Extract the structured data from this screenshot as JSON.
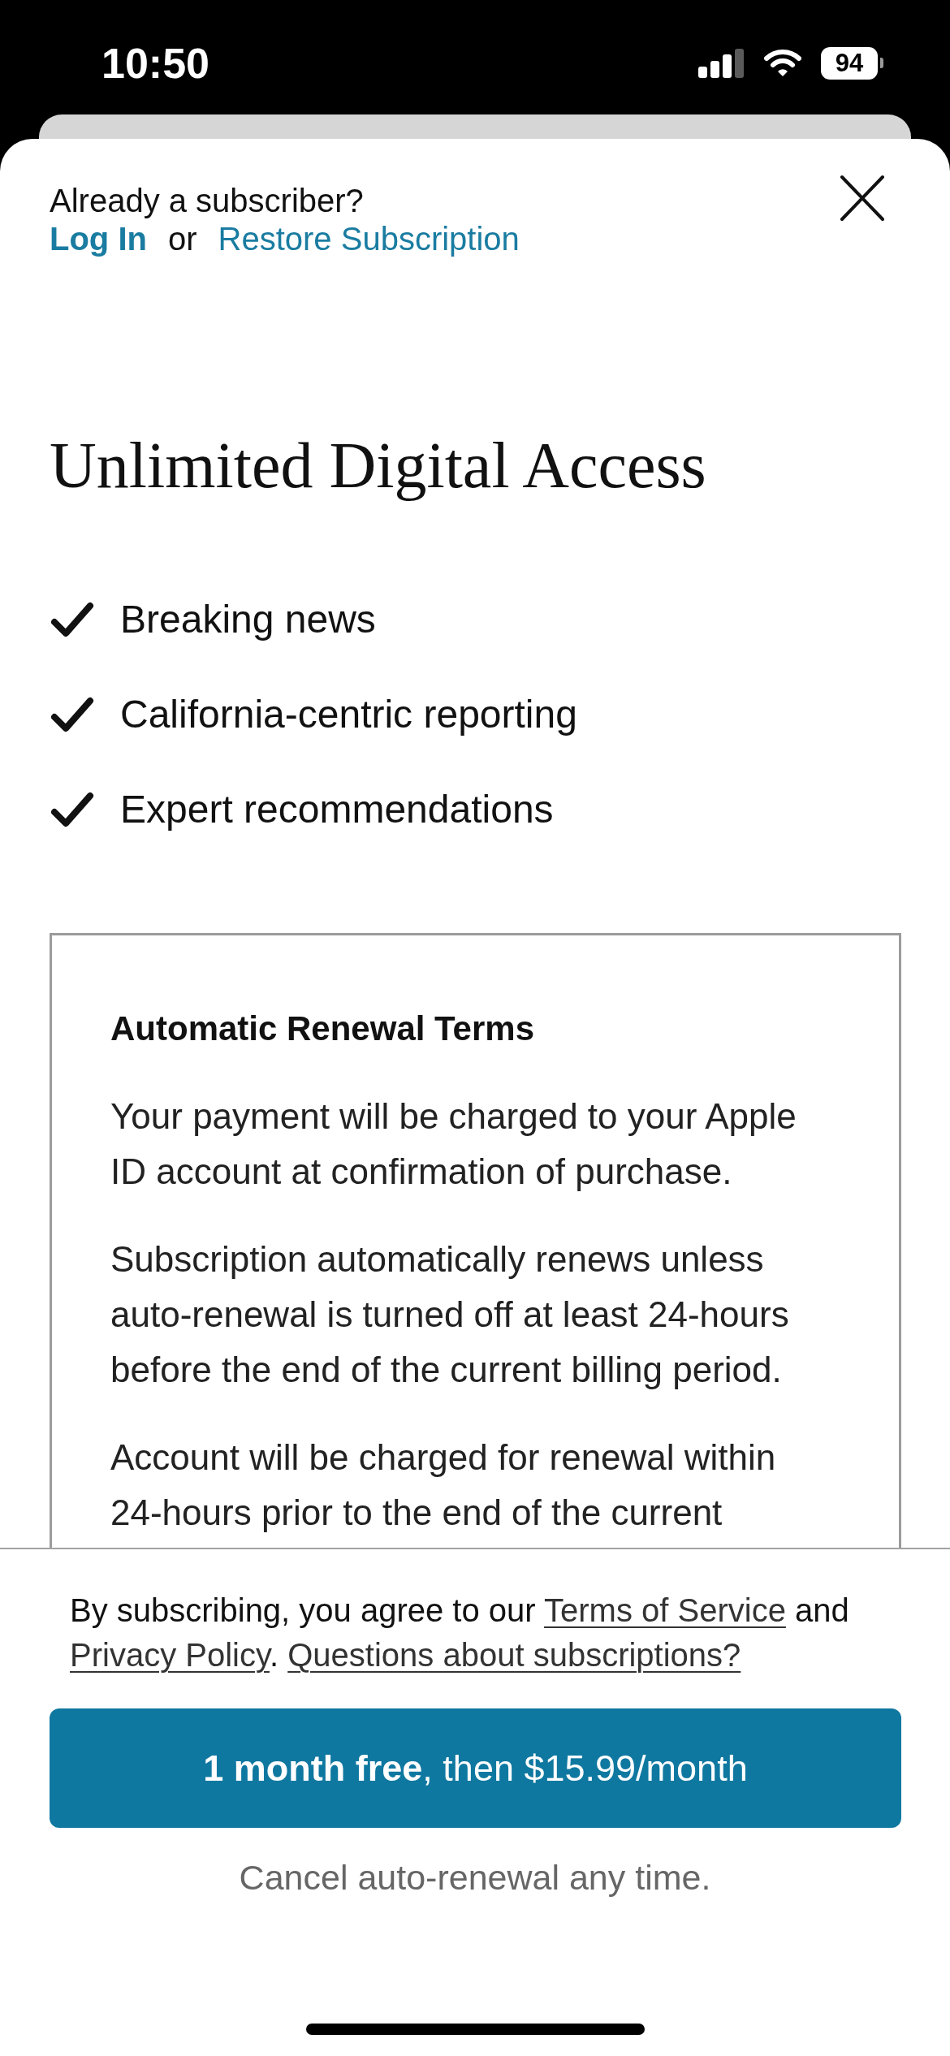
{
  "status_bar": {
    "time": "10:50",
    "battery": "94"
  },
  "account": {
    "prompt": "Already a subscriber?",
    "login_link": "Log In",
    "separator": "or",
    "restore_link": "Restore Subscription"
  },
  "title": "Unlimited Digital Access",
  "features": [
    "Breaking news",
    "California-centric reporting",
    "Expert recommendations"
  ],
  "terms": {
    "heading": "Automatic Renewal Terms",
    "paragraphs": [
      "Your payment will be charged to your Apple ID account at confirmation of purchase.",
      "Subscription automatically renews unless auto-renewal is turned off at least 24-hours before the end of the current billing period.",
      "Account will be charged for renewal within 24-hours prior to the end of the current"
    ]
  },
  "footer": {
    "agreement": [
      {
        "kind": "text",
        "text": "By subscribing, you agree to our "
      },
      {
        "kind": "link",
        "text": "Terms of Service"
      },
      {
        "kind": "text",
        "text": " and "
      },
      {
        "kind": "link",
        "text": "Privacy Policy"
      },
      {
        "kind": "text",
        "text": ". "
      },
      {
        "kind": "link",
        "text": "Questions about subscriptions?"
      }
    ],
    "subscribe_button": "**1 month free**, then $15.99/month",
    "note": "Cancel auto-renewal any time."
  }
}
